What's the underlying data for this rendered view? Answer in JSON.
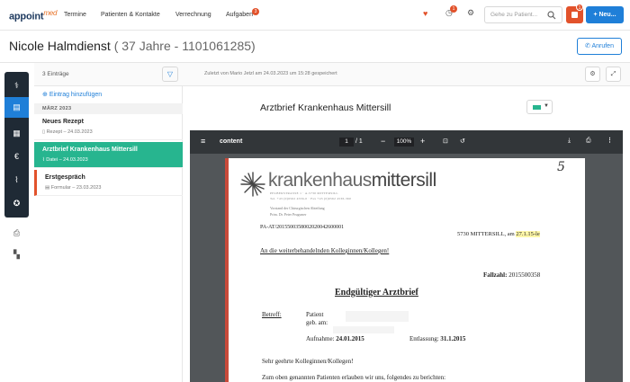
{
  "nav": {
    "logo": "appoint",
    "logo_suffix": "med",
    "items": [
      "Termine",
      "Patienten & Kontakte",
      "Verrechnung",
      "Aufgaben"
    ],
    "tasks_badge": "3",
    "clock_badge": "1",
    "notif_badge": "1",
    "search_placeholder": "Gehe zu Patient...",
    "new_button": "+ Neu..."
  },
  "patient": {
    "name": "Nicole Halmdienst",
    "meta": " ( 37 Jahre - 1101061285)",
    "call_button": "Anrufen"
  },
  "list": {
    "count": "3 Einträge",
    "add_label": "Eintrag hinzufügen",
    "section": "MÄRZ 2023",
    "items": [
      {
        "title": "Neues Rezept",
        "sub": "Rezept – 24.03.2023"
      },
      {
        "title": "Arztbrief Krankenhaus Mittersill",
        "sub": "Datei – 24.03.2023"
      },
      {
        "title": "Erstgespräch",
        "sub": "Formular – 23.03.2023"
      }
    ]
  },
  "main": {
    "saved_info": "Zuletzt von Mario Jetzl am 24.03.2023 um 15:28 gespeichert",
    "doc_title": "Arztbrief Krankenhaus Mittersill",
    "tag_color": "#27b58f"
  },
  "viewer": {
    "filename": "content",
    "page": "1",
    "pages": "/  1",
    "zoom": "100%"
  },
  "letter": {
    "hospital_a": "krankenhaus",
    "hospital_b": "mittersill",
    "address_1": "PELBERSTRASSE 1 · A-5730 MITTERSILL",
    "address_2": "Tel. +43 (0)6562 4536-0 · Fax +43 (0)6562 4536-360",
    "dept_1": "Vorstand der Chirurgischen Abteilung",
    "dept_2": "Prim. Dr. Peter Prugsmer",
    "ref": "PA-AT/2015500358002020042600001",
    "city_date": "5730 MITTERSILL, am",
    "date": "27.1.15-le",
    "to": "An die weiterbehandelnden Kolleginnen/Kollegen!",
    "case_label": "Fallzahl:",
    "case_no": "2015500358",
    "heading": "Endgültiger Arztbrief",
    "betreff": "Betreff:",
    "patient_label": "Patient",
    "born_label": "geb. am:",
    "admission_label": "Aufnahme:",
    "admission": "24.01.2015",
    "discharge_label": "Entlassung:",
    "discharge": "31.1.2015",
    "greeting": "Sehr geehrte Kolleginnen/Kollegen!",
    "body": "Zum oben genannten Patienten erlauben wir uns, folgendes zu berichten:",
    "handwritten": "5"
  }
}
